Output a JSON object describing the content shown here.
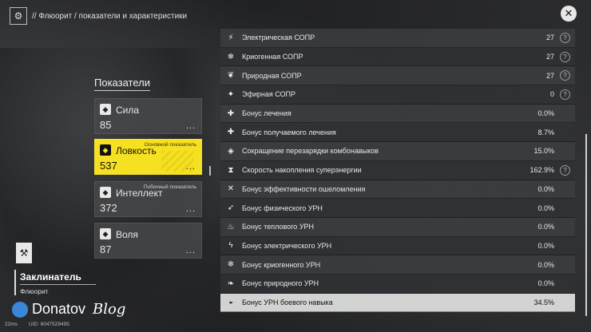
{
  "header": {
    "breadcrumb": "// Флюорит / показатели и характеристики",
    "logo_icon": "character-menu-icon",
    "close_icon": "close-icon"
  },
  "stats_panel": {
    "title": "Показатели",
    "cards": [
      {
        "name": "Сила",
        "value": "85",
        "tag": "",
        "icon": "strength-icon",
        "active": false
      },
      {
        "name": "Ловкость",
        "value": "537",
        "tag": "Основной показатель",
        "icon": "agility-icon",
        "active": true
      },
      {
        "name": "Интеллект",
        "value": "372",
        "tag": "Побочный показатель",
        "icon": "intellect-icon",
        "active": false
      },
      {
        "name": "Воля",
        "value": "87",
        "tag": "",
        "icon": "will-icon",
        "active": false
      }
    ],
    "more_label": "..."
  },
  "character": {
    "class": "Заклинатель",
    "name": "Флюорит"
  },
  "watermark": {
    "brand": "Donatov",
    "suffix": "Blog"
  },
  "footer": {
    "ping": "22ms",
    "uid": "UID: 6047529495"
  },
  "attributes": [
    {
      "label": "Электрическая СОПР",
      "value": "27",
      "help": true,
      "glyph": "⚡"
    },
    {
      "label": "Криогенная СОПР",
      "value": "27",
      "help": true,
      "glyph": "❄"
    },
    {
      "label": "Природная СОПР",
      "value": "27",
      "help": true,
      "glyph": "❦"
    },
    {
      "label": "Эфирная СОПР",
      "value": "0",
      "help": true,
      "glyph": "✦"
    },
    {
      "label": "Бонус лечения",
      "value": "0.0%",
      "help": false,
      "glyph": "✚"
    },
    {
      "label": "Бонус получаемого лечения",
      "value": "8.7%",
      "help": false,
      "glyph": "✚"
    },
    {
      "label": "Сокращение перезарядки комбонавыков",
      "value": "15.0%",
      "help": false,
      "glyph": "◈"
    },
    {
      "label": "Скорость накопления суперэнергии",
      "value": "162.9%",
      "help": true,
      "glyph": "⧗"
    },
    {
      "label": "Бонус эффективности ошеломления",
      "value": "0.0%",
      "help": false,
      "glyph": "✕"
    },
    {
      "label": "Бонус физического УРН",
      "value": "0.0%",
      "help": false,
      "glyph": "➶"
    },
    {
      "label": "Бонус теплового УРН",
      "value": "0.0%",
      "help": false,
      "glyph": "♨"
    },
    {
      "label": "Бонус электрического УРН",
      "value": "0.0%",
      "help": false,
      "glyph": "ϟ"
    },
    {
      "label": "Бонус криогенного УРН",
      "value": "0.0%",
      "help": false,
      "glyph": "❄"
    },
    {
      "label": "Бонус природного УРН",
      "value": "0.0%",
      "help": false,
      "glyph": "❧"
    },
    {
      "label": "Бонус УРН боевого навыка",
      "value": "34.5%",
      "help": false,
      "glyph": "◒",
      "highlight": true
    }
  ],
  "help_glyph": "?"
}
